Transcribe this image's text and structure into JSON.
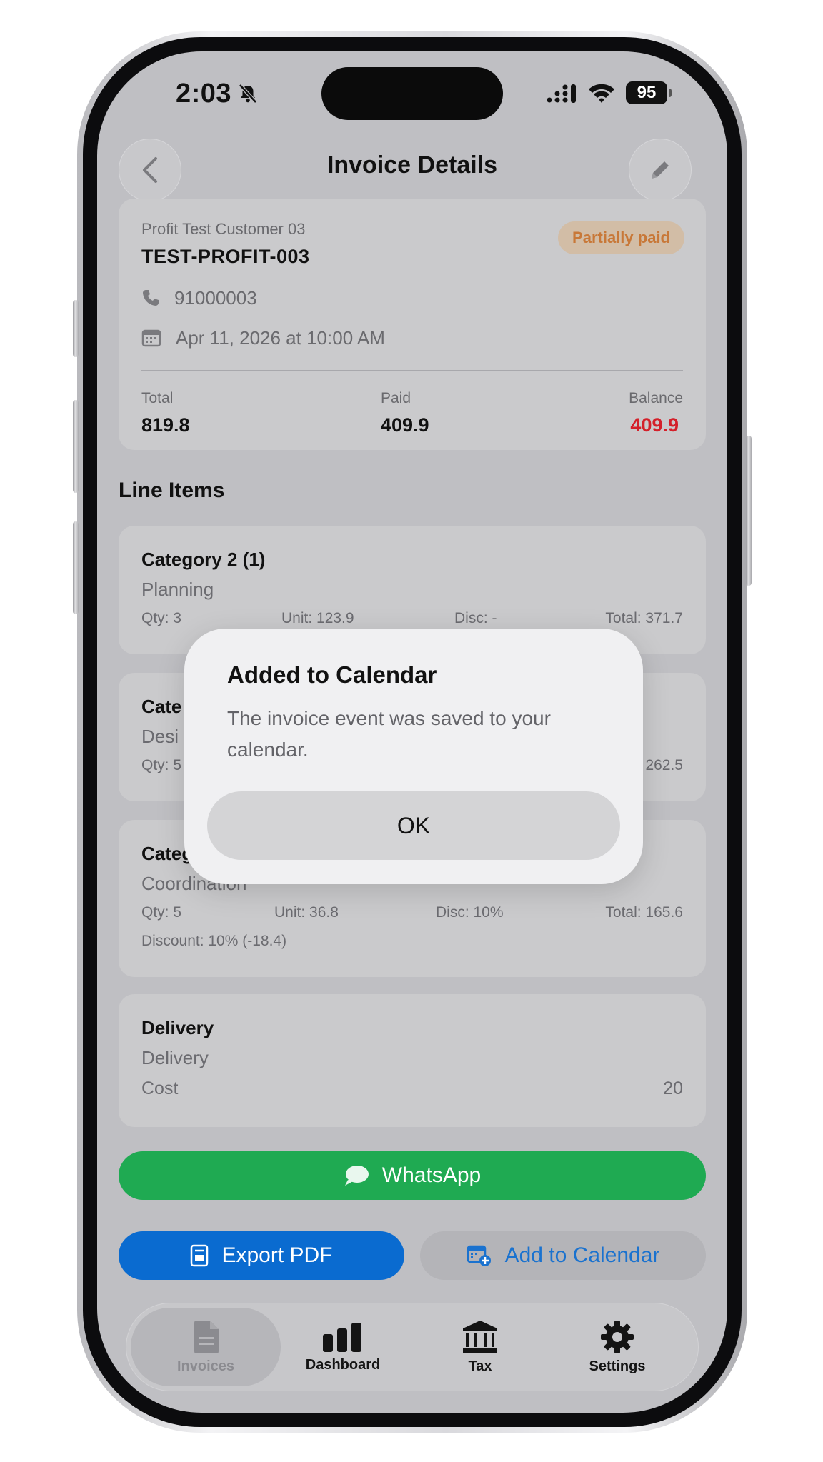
{
  "status_bar": {
    "time": "2:03",
    "battery": "95"
  },
  "header": {
    "title": "Invoice Details"
  },
  "invoice": {
    "customer": "Profit Test Customer 03",
    "number": "TEST-PROFIT-003",
    "status": "Partially paid",
    "phone": "91000003",
    "date": "Apr 11, 2026 at 10:00 AM",
    "totals": {
      "total_label": "Total",
      "total_value": "819.8",
      "paid_label": "Paid",
      "paid_value": "409.9",
      "balance_label": "Balance",
      "balance_value": "409.9"
    }
  },
  "line_items_title": "Line Items",
  "line_items": [
    {
      "title": "Category 2 (1)",
      "subtitle": "Planning",
      "qty": "Qty: 3",
      "unit": "Unit: 123.9",
      "disc": "Disc: -",
      "total": "Total: 371.7"
    },
    {
      "title": "Cate",
      "subtitle": "Desi",
      "qty": "Qty: 5",
      "total": "262.5"
    },
    {
      "title": "Categ",
      "subtitle": "Coordination",
      "qty": "Qty: 5",
      "unit": "Unit: 36.8",
      "disc": "Disc: 10%",
      "total": "Total: 165.6",
      "discount_note": "Discount: 10% (-18.4)"
    }
  ],
  "delivery": {
    "title": "Delivery",
    "subtitle": "Delivery",
    "cost_label": "Cost",
    "cost_value": "20"
  },
  "actions": {
    "whatsapp": "WhatsApp",
    "export_pdf": "Export PDF",
    "add_to_calendar": "Add to Calendar"
  },
  "tabs": [
    {
      "label": "Invoices",
      "icon": "document-icon"
    },
    {
      "label": "Dashboard",
      "icon": "bar-chart-icon"
    },
    {
      "label": "Tax",
      "icon": "bank-icon"
    },
    {
      "label": "Settings",
      "icon": "gear-icon"
    }
  ],
  "dialog": {
    "title": "Added to Calendar",
    "message": "The invoice event was saved to your calendar.",
    "ok": "OK"
  },
  "colors": {
    "whatsapp_green": "#1faa52",
    "export_blue": "#0a6bd0",
    "balance_red": "#d4202a",
    "status_orange": "#c87838"
  }
}
